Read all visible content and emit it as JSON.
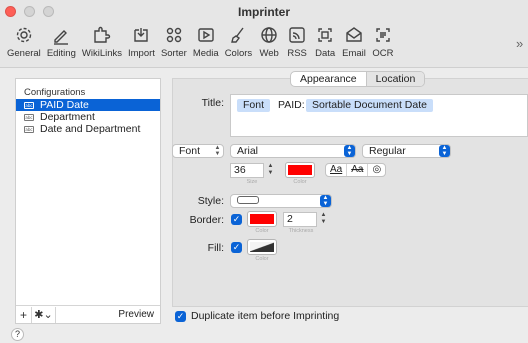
{
  "window": {
    "title": "Imprinter"
  },
  "toolbar": {
    "items": [
      {
        "label": "General",
        "icon": "gear-icon"
      },
      {
        "label": "Editing",
        "icon": "pencil-icon"
      },
      {
        "label": "WikiLinks",
        "icon": "puzzle-icon"
      },
      {
        "label": "Import",
        "icon": "import-icon"
      },
      {
        "label": "Sorter",
        "icon": "sorter-icon"
      },
      {
        "label": "Media",
        "icon": "media-icon"
      },
      {
        "label": "Colors",
        "icon": "paintbrush-icon"
      },
      {
        "label": "Web",
        "icon": "globe-icon"
      },
      {
        "label": "RSS",
        "icon": "rss-icon"
      },
      {
        "label": "Data",
        "icon": "data-icon"
      },
      {
        "label": "Email",
        "icon": "envelope-icon"
      },
      {
        "label": "OCR",
        "icon": "ocr-icon"
      }
    ],
    "overflow": "»"
  },
  "configurations": {
    "header": "Configurations",
    "items": [
      {
        "label": "PAID Date",
        "icon": "abc",
        "selected": true
      },
      {
        "label": "Department",
        "icon": "abc",
        "selected": false
      },
      {
        "label": "Date and Department",
        "icon": "abc",
        "selected": false
      }
    ],
    "add_label": "+",
    "gear_label": "✱⌄",
    "preview_label": "Preview"
  },
  "tabs": {
    "appearance": "Appearance",
    "location": "Location"
  },
  "title_field": {
    "label": "Title:",
    "token_font": "Font",
    "text_paid": "PAID:",
    "token_sortable": "Sortable Document Date"
  },
  "font": {
    "selector_label": "Font",
    "family": "Arial",
    "style": "Regular",
    "size_value": "36",
    "size_caption": "Size",
    "color_caption": "Color",
    "color": "#ff0000",
    "seg_underline": "Aa",
    "seg_strike": "Aa",
    "seg_outline": "◎"
  },
  "style": {
    "label": "Style:"
  },
  "border": {
    "label": "Border:",
    "checked": true,
    "color": "#ff0000",
    "color_caption": "Color",
    "thickness_value": "2",
    "thickness_caption": "Thickness"
  },
  "fill": {
    "label": "Fill:",
    "checked": true,
    "color_caption": "Color"
  },
  "duplicate": {
    "label": "Duplicate item before Imprinting",
    "checked": true
  },
  "help": {
    "label": "?"
  }
}
